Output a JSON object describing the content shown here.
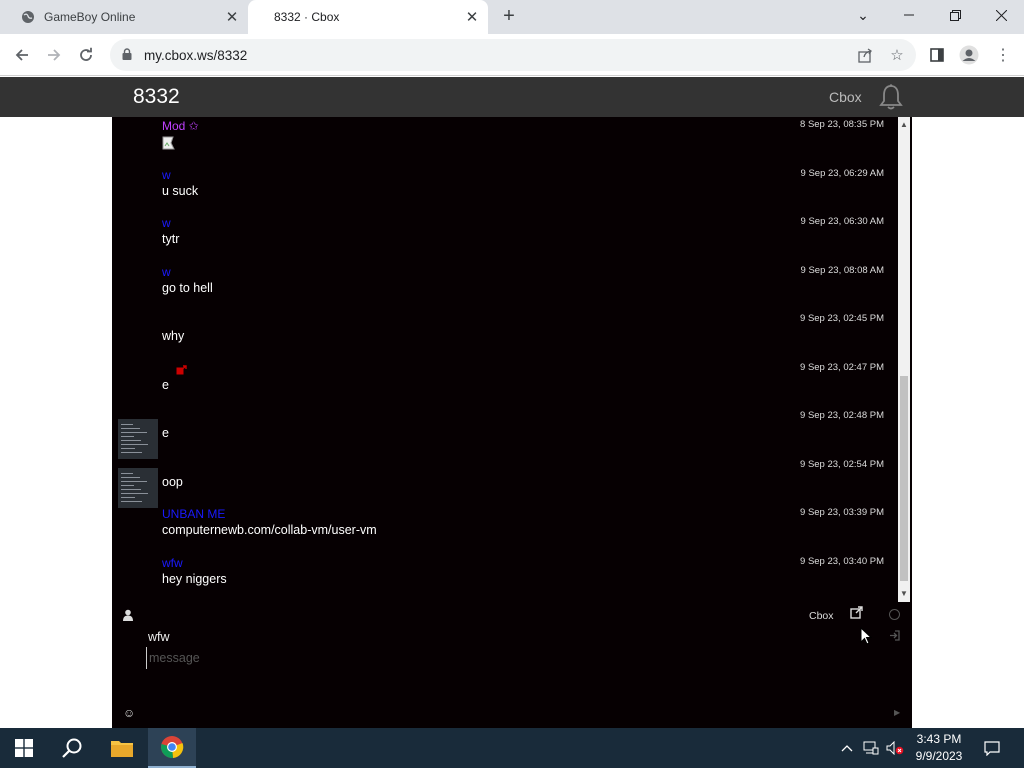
{
  "browser": {
    "tabs": [
      {
        "title": "GameBoy Online",
        "active": false
      },
      {
        "title": "8332 · Cbox",
        "active": true
      }
    ],
    "url": "my.cbox.ws/8332"
  },
  "page": {
    "site_title": "8332",
    "header_link": "Cbox",
    "messages": [
      {
        "user": "Mod ✩",
        "user_color": "#c040ff",
        "time": "8 Sep 23, 08:35 PM",
        "text": "",
        "avatar": false,
        "broken_image": true
      },
      {
        "user": "w",
        "user_color": "#1a1aff",
        "time": "9 Sep 23, 06:29 AM",
        "text": "u suck",
        "avatar": false
      },
      {
        "user": "w",
        "user_color": "#1a1aff",
        "time": "9 Sep 23, 06:30 AM",
        "text": "tytr",
        "avatar": false
      },
      {
        "user": "w",
        "user_color": "#1a1aff",
        "time": "9 Sep 23, 08:08 AM",
        "text": "go to hell",
        "avatar": false
      },
      {
        "user": "",
        "user_color": "#1a1aff",
        "time": "9 Sep 23, 02:45 PM",
        "text": "why",
        "avatar": false
      },
      {
        "user": "",
        "user_color": "#1a1aff",
        "time": "9 Sep 23, 02:47 PM",
        "text": "e",
        "avatar": false,
        "red_icon": true
      },
      {
        "user": "",
        "user_color": "#1a1aff",
        "time": "9 Sep 23, 02:48 PM",
        "text": "e",
        "avatar": true
      },
      {
        "user": "",
        "user_color": "#1a1aff",
        "time": "9 Sep 23, 02:54 PM",
        "text": "oop",
        "avatar": true
      },
      {
        "user": "UNBAN ME",
        "user_color": "#1a1aff",
        "time": "9 Sep 23, 03:39 PM",
        "text": "computernewb.com/collab-vm/user-vm",
        "avatar": false
      },
      {
        "user": "wfw",
        "user_color": "#1a1aff",
        "time": "9 Sep 23, 03:40 PM",
        "text": "hey niggers",
        "avatar": false
      }
    ],
    "form": {
      "cbox_label": "Cbox",
      "username": "wfw",
      "message_placeholder": "message"
    }
  },
  "taskbar": {
    "time": "3:43 PM",
    "date": "9/9/2023"
  }
}
